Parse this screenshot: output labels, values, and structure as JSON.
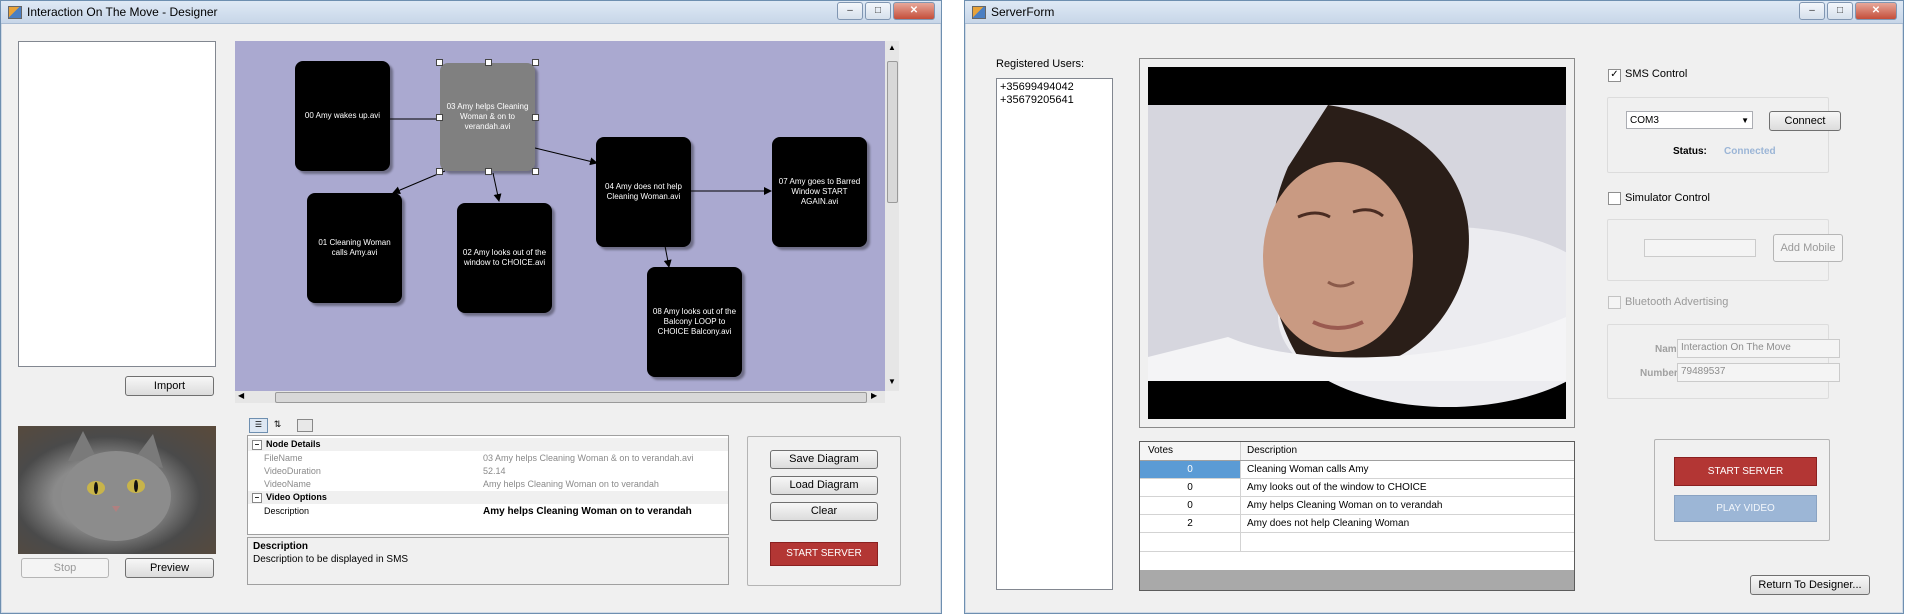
{
  "designer": {
    "title": "Interaction On The Move - Designer",
    "buttons": {
      "import": "Import",
      "stop": "Stop",
      "preview": "Preview",
      "save_diagram": "Save Diagram",
      "load_diagram": "Load Diagram",
      "clear": "Clear",
      "start_server": "START SERVER"
    },
    "nodes": [
      {
        "label": "00 Amy wakes up.avi"
      },
      {
        "label": "03 Amy helps Cleaning Woman & on to verandah.avi"
      },
      {
        "label": "01 Cleaning Woman calls Amy.avi"
      },
      {
        "label": "02 Amy looks out of the window to CHOICE.avi"
      },
      {
        "label": "04 Amy does not help Cleaning Woman.avi"
      },
      {
        "label": "07 Amy goes to Barred Window START AGAIN.avi"
      },
      {
        "label": "08 Amy looks out of the Balcony LOOP to CHOICE Balcony.avi"
      }
    ],
    "properties": {
      "cat_node": "Node Details",
      "cat_video": "Video Options",
      "rows": [
        {
          "name": "FileName",
          "value": "03 Amy helps Cleaning Woman & on to verandah.avi"
        },
        {
          "name": "VideoDuration",
          "value": "52.14"
        },
        {
          "name": "VideoName",
          "value": "Amy helps Cleaning Woman  on to verandah"
        }
      ],
      "desc_row": {
        "name": "Description",
        "value": "Amy helps Cleaning Woman  on to verandah"
      },
      "help_title": "Description",
      "help_text": "Description to be displayed in SMS"
    }
  },
  "server": {
    "title": "ServerForm",
    "registered_label": "Registered Users:",
    "users": [
      "+35699494042",
      "+35679205641"
    ],
    "grid": {
      "col_votes": "Votes",
      "col_desc": "Description",
      "rows": [
        {
          "votes": "0",
          "desc": "Cleaning Woman calls Amy"
        },
        {
          "votes": "0",
          "desc": "Amy looks out of the window to CHOICE"
        },
        {
          "votes": "0",
          "desc": "Amy helps Cleaning Woman  on to verandah"
        },
        {
          "votes": "2",
          "desc": "Amy does not help Cleaning Woman"
        }
      ]
    },
    "sms_control": "SMS Control",
    "com_port": "COM3",
    "connect": "Connect",
    "status_label": "Status:",
    "status_value": "Connected",
    "simulator_control": "Simulator Control",
    "add_mobile": "Add Mobile",
    "bluetooth": "Bluetooth Advertising",
    "name_label": "Name:",
    "name_value": "Interaction On The Move",
    "number_label": "Number:",
    "number_value": "79489537",
    "start_server": "START SERVER",
    "play_video": "PLAY VIDEO",
    "return": "Return To Designer..."
  },
  "colors": {
    "canvas": "#aaa9d0",
    "start_server": "#b33634",
    "play_video": "#9cb6d6",
    "status_connected": "#9bb5d6",
    "selected_cell": "#5b9bd5"
  }
}
